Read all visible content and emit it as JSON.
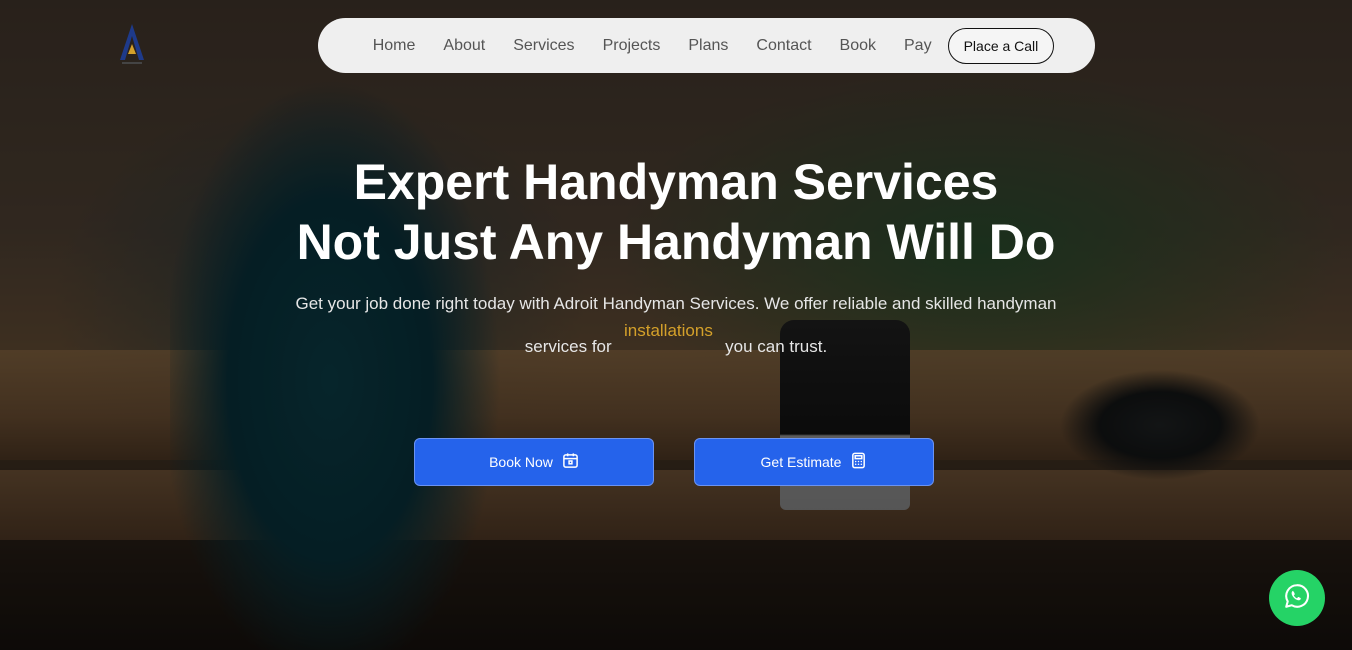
{
  "nav": {
    "items": [
      {
        "label": "Home"
      },
      {
        "label": "About"
      },
      {
        "label": "Services"
      },
      {
        "label": "Projects"
      },
      {
        "label": "Plans"
      },
      {
        "label": "Contact"
      },
      {
        "label": "Book"
      },
      {
        "label": "Pay"
      }
    ],
    "call_label": "Place a Call"
  },
  "hero": {
    "title_line1": "Expert Handyman Services",
    "title_line2": "Not Just Any Handyman Will Do",
    "subtitle_line1": "Get your job done right today with Adroit Handyman Services. We offer reliable and skilled handyman",
    "subtitle_before": "services for",
    "subtitle_rotating": "installations",
    "subtitle_after": "you can trust."
  },
  "buttons": {
    "book_label": "Book Now",
    "book_icon": "calendar-icon",
    "estimate_label": "Get Estimate",
    "estimate_icon": "calculator-icon"
  },
  "floating": {
    "whatsapp_icon": "whatsapp-icon"
  },
  "colors": {
    "accent": "#2563eb",
    "highlight": "#d4a02a",
    "whatsapp": "#25d366"
  }
}
